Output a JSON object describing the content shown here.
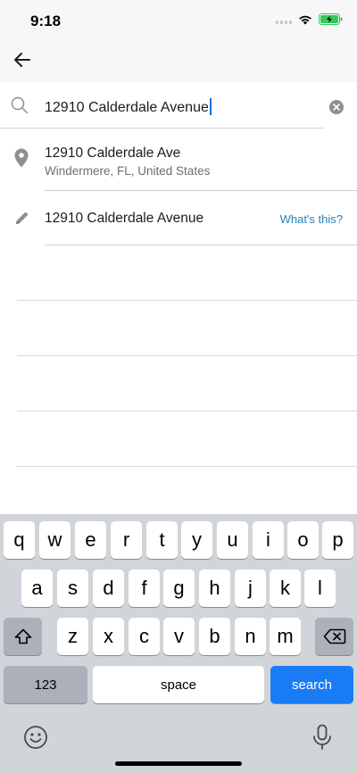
{
  "status_bar": {
    "time": "9:18"
  },
  "search": {
    "query": "12910 Calderdale Avenue",
    "placeholder": ""
  },
  "results": [
    {
      "icon": "location-pin-icon",
      "title": "12910 Calderdale Ave",
      "subtitle": "Windermere, FL, United States"
    },
    {
      "icon": "pencil-icon",
      "title": "12910 Calderdale Avenue",
      "link": "What's this?"
    }
  ],
  "keyboard": {
    "row1": [
      "q",
      "w",
      "e",
      "r",
      "t",
      "y",
      "u",
      "i",
      "o",
      "p"
    ],
    "row2": [
      "a",
      "s",
      "d",
      "f",
      "g",
      "h",
      "j",
      "k",
      "l"
    ],
    "row3": [
      "z",
      "x",
      "c",
      "v",
      "b",
      "n",
      "m"
    ],
    "numbers_label": "123",
    "space_label": "space",
    "search_label": "search"
  },
  "colors": {
    "accent": "#1a7cf5",
    "link": "#2a7fba",
    "battery": "#34c759"
  }
}
